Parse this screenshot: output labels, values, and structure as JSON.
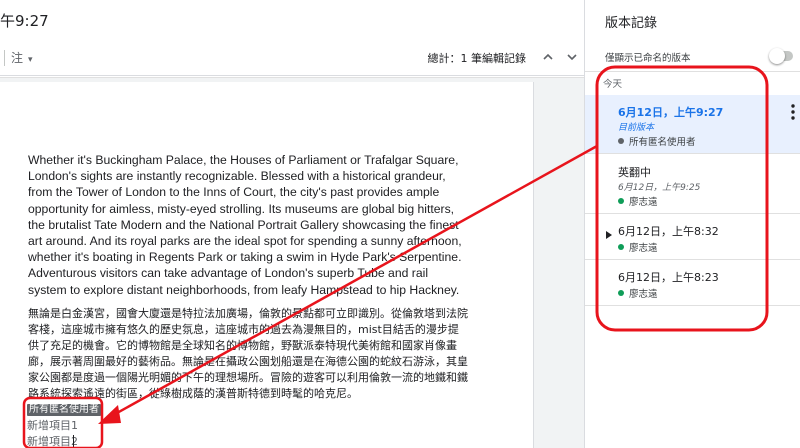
{
  "header": {
    "doc_title": "午9:27"
  },
  "toolbar": {
    "comment_label": "注",
    "total_edits": "總計：1 筆編輯記錄"
  },
  "document": {
    "para_en": "Whether it's Buckingham Palace, the Houses of Parliament or Trafalgar Square, London's sights are instantly recognizable. Blessed with a historical grandeur, from the Tower of London to the Inns of Court, the city's past provides ample opportunity for aimless, misty-eyed strolling. Its museums are global big hitters, the brutalist Tate Modern and the National Portrait Gallery showcasing the finest art around. And its royal parks are the ideal spot for spending a sunny afternoon, whether it's boating in Regents Park or taking a swim in Hyde Park's Serpentine. Adventurous visitors can take advantage of London's superb Tube and rail system to explore distant neighborhoods, from leafy Hampstead to hip Hackney.",
    "para_zh": "無論是白金漢宮，國會大廈還是特拉法加廣場，倫敦的景點都可立即識別。從倫敦塔到法院客棧，這座城市擁有悠久的歷史氛息，這座城市的過去為漫無目的，mist目結舌的漫步提供了充足的機會。它的博物館是全球知名的博物館，野獸派泰特現代美術館和國家肖像畫廊，展示著周圍最好的藝術品。無論是在攝政公園划船還是在海德公園的蛇紋石游泳，其皇家公園都是度過一個陽光明媚的下午的理想場所。冒險的遊客可以利用倫敦一流的地鐵和鐵路系統探索遙遠的街區，從綠樹成蔭的漢普斯特德到時髦的哈克尼。",
    "anon_tag": "所有匿名使用者",
    "new_item_1": "新增項目1",
    "new_item_2": "新增項目2"
  },
  "panel": {
    "title": "版本記錄",
    "named_only_label": "僅顯示已命名的版本",
    "named_only_on": false,
    "group_today": "今天",
    "versions": [
      {
        "date": "6月12日，上午9:27",
        "sub": "目前版本",
        "user": "所有匿名使用者",
        "selected": true
      },
      {
        "date": "英翻中",
        "sub": "6月12日，上午9:25",
        "user": "廖志遠",
        "selected": false
      },
      {
        "date": "6月12日，上午8:32",
        "sub": "",
        "user": "廖志遠",
        "selected": false
      },
      {
        "date": "6月12日，上午8:23",
        "sub": "",
        "user": "廖志遠",
        "selected": false
      }
    ]
  },
  "colors": {
    "accent": "#1a73e8",
    "selected_bg": "#e8f0fe",
    "annotation": "#e8141c",
    "user_teal": "#0f9d58",
    "user_grey": "#5f6368"
  },
  "icons": [
    "chevron-up-icon",
    "chevron-down-icon",
    "more-vert-icon",
    "expand-caret-icon",
    "dropdown-caret-icon"
  ]
}
